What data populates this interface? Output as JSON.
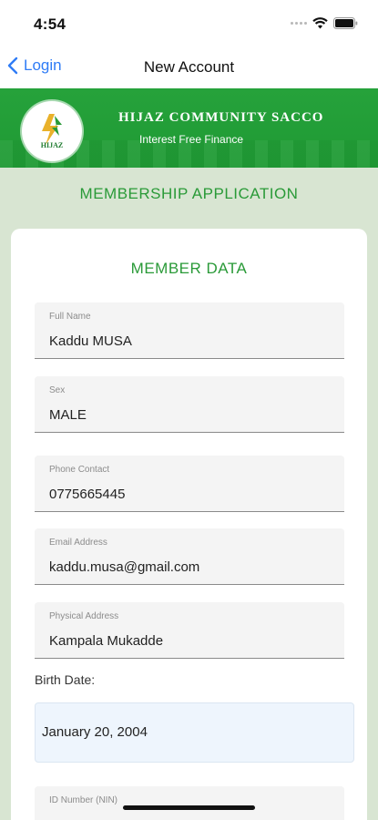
{
  "status": {
    "time": "4:54"
  },
  "nav": {
    "back_label": "Login",
    "title": "New Account"
  },
  "banner": {
    "logo_text": "HIJAZ",
    "title": "HIJAZ COMMUNITY SACCO",
    "subtitle": "Interest Free Finance",
    "color": "#1f9a34"
  },
  "page": {
    "heading": "MEMBERSHIP APPLICATION"
  },
  "card": {
    "heading": "MEMBER DATA",
    "fields": [
      {
        "label": "Full Name",
        "value": "Kaddu MUSA"
      },
      {
        "label": "Sex",
        "value": "MALE"
      },
      {
        "label": "Phone Contact",
        "value": "0775665445"
      },
      {
        "label": "Email Address",
        "value": "kaddu.musa@gmail.com"
      },
      {
        "label": "Physical Address",
        "value": "Kampala Mukadde"
      }
    ],
    "birth_date_label": "Birth Date:",
    "birth_date_value": "January 20, 2004",
    "id_field_label": "ID Number (NIN)"
  },
  "colors": {
    "accent": "#2a9a38",
    "link": "#2f7cf6",
    "background": "#d8e5d2"
  }
}
